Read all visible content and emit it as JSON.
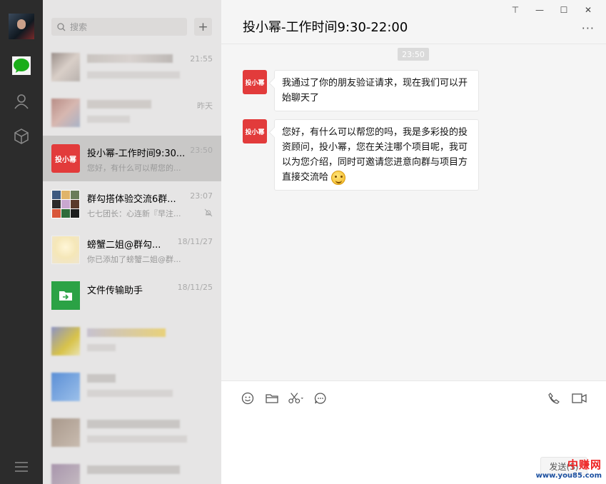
{
  "search": {
    "placeholder": "搜索",
    "add_label": "+"
  },
  "conversations": [
    {
      "name": "",
      "time": "21:55",
      "preview": ""
    },
    {
      "name": "",
      "time": "昨天",
      "preview": ""
    },
    {
      "name": "投小幂-工作时间9:30...",
      "time": "23:50",
      "preview": "您好，有什么可以帮您的...",
      "avatar_text": "投小幂"
    },
    {
      "name": "群勾搭体验交流6群...",
      "time": "23:07",
      "preview": "七七团长：心连新『早注...",
      "muted": true
    },
    {
      "name": "螃蟹二姐@群勾...",
      "time": "18/11/27",
      "preview": "你已添加了螃蟹二姐@群..."
    },
    {
      "name": "文件传输助手",
      "time": "18/11/25",
      "preview": ""
    }
  ],
  "chat": {
    "title": "投小幂-工作时间9:30-22:00",
    "more_label": "···",
    "timestamp": "23:50",
    "avatar_text": "投小幂",
    "messages": [
      {
        "text": "我通过了你的朋友验证请求，现在我们可以开始聊天了"
      },
      {
        "text": "您好，有什么可以帮您的吗，我是多彩投的投资顾问，投小幂，您在关注哪个项目呢，我可以为您介绍，同时可邀请您进意向群与项目方直接交流哈"
      }
    ],
    "send_label": "发送(S)"
  },
  "window_controls": {
    "pin": "⊤",
    "minimize": "—",
    "maximize": "☐",
    "close": "✕"
  },
  "watermark": {
    "line1": "中赚网",
    "line2": "www.you85.com"
  },
  "colors": {
    "rail": "#2c2c2c",
    "list": "#e6e5e5",
    "active": "#c9c8c7",
    "accent_green": "#1aad19",
    "avatar_red": "#e23b3b"
  }
}
